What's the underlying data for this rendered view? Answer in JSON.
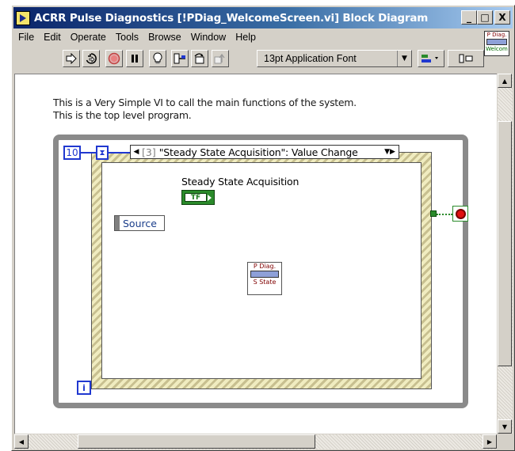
{
  "window": {
    "title": "ACRR Pulse Diagnostics [!PDiag_WelcomeScreen.vi] Block Diagram",
    "controls": {
      "minimize": "_",
      "maximize": "□",
      "close": "X"
    }
  },
  "menu": {
    "items": [
      {
        "label": "File"
      },
      {
        "label": "Edit"
      },
      {
        "label": "Operate"
      },
      {
        "label": "Tools"
      },
      {
        "label": "Browse"
      },
      {
        "label": "Window"
      },
      {
        "label": "Help"
      }
    ]
  },
  "vi_icon": {
    "top": "P Diag.",
    "bottom": "Welcom"
  },
  "toolbar": {
    "run_icon": "run-arrow-icon",
    "run_continuous_icon": "run-continuously-icon",
    "abort_icon": "abort-icon",
    "pause_icon": "pause-icon",
    "highlight_icon": "lightbulb-icon",
    "font": "13pt Application Font",
    "font_arrow": "▼"
  },
  "diagram": {
    "comment_line1": "This is a Very Simple VI to call the main functions of the system.",
    "comment_line2": "This is the top level program.",
    "timeout_constant": "10",
    "event_case": {
      "index": "[3]",
      "label": "\"Steady State Acquisition\": Value Change"
    },
    "control_label": "Steady State Acquisition",
    "bool_terminal_text": "TF",
    "source_label": "Source",
    "subvi": {
      "top": "P Diag.",
      "bottom": "S State"
    },
    "iteration_label": "i"
  },
  "colors": {
    "title_start": "#0a246a",
    "title_end": "#a6caf0",
    "wire_blue": "#2038d0",
    "bool_green": "#2a8a2a",
    "stop_red": "#e01010"
  }
}
